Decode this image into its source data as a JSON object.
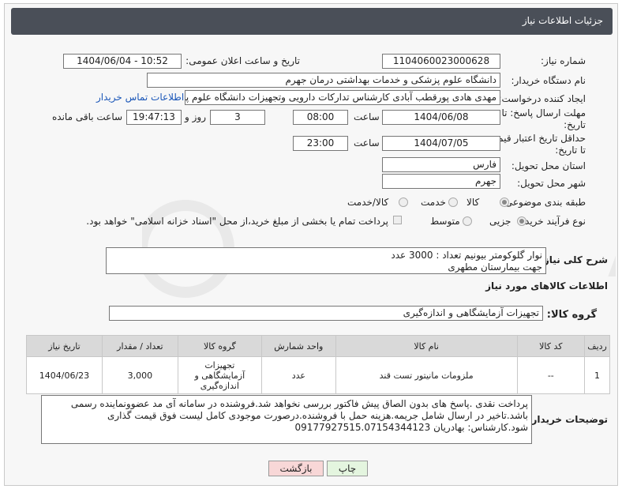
{
  "title": "جزئیات اطلاعات نیاز",
  "fields": {
    "need_number_label": "شماره نیاز:",
    "need_number": "1104060023000628",
    "announce_label": "تاریخ و ساعت اعلان عمومی:",
    "announce_value": "1404/06/04 - 10:52",
    "buyer_label": "نام دستگاه خریدار:",
    "buyer_value": "دانشگاه علوم پزشکی و خدمات بهداشتی  درمان جهرم",
    "creator_label": "ایجاد کننده درخواست:",
    "creator_value": "مهدی هادی پورقطب آبادی کارشناس تدارکات دارویی وتجهیزات دانشگاه علوم پزشکی جهرم",
    "contact_link": "اطلاعات تماس خریدار",
    "deadline_label_1": "مهلت ارسال پاسخ: تا",
    "deadline_label_2": "تاریخ:",
    "deadline_date": "1404/06/08",
    "time_label": "ساعت",
    "deadline_time": "08:00",
    "days_value": "3",
    "days_label": "روز و",
    "remaining_time": "19:47:13",
    "remaining_label": "ساعت باقی مانده",
    "validity_label_1": "حداقل تاریخ اعتبار قیمت:",
    "validity_label_2": "تا تاریخ:",
    "validity_date": "1404/07/05",
    "validity_time": "23:00",
    "province_label": "استان محل تحویل:",
    "province_value": "فارس",
    "city_label": "شهر محل تحویل:",
    "city_value": "جهرم",
    "category_label": "طبقه بندی موضوعی:",
    "category_options": [
      "کالا",
      "خدمت",
      "کالا/خدمت"
    ],
    "process_label": "نوع فرآیند خرید :",
    "process_options": [
      "جزیی",
      "متوسط"
    ],
    "payment_note": "پرداخت تمام یا بخشی از مبلغ خرید،از محل \"اسناد خزانه اسلامی\" خواهد بود.",
    "description_label": "شرح کلی نیاز:",
    "description_line1": "نوار گلوکومتر بیونیم        تعداد : 3000 عدد",
    "description_line2": "جهت بیمارستان مطهری",
    "goods_info_heading": "اطلاعات کالاهای مورد نیاز",
    "goods_group_label": "گروه کالا:",
    "goods_group_value": "تجهیزات آزمایشگاهی و اندازه‌گیری",
    "buyer_notes_label": "توضیحات خریدار:",
    "buyer_notes": "پرداخت نقدی .پاسخ های بدون الصاق پیش فاکتور بررسی نخواهد شد.فروشنده در سامانه آی مد عضوونماینده رسمی باشد.تاخیر در ارسال شامل جریمه.هزینه حمل با فروشنده.درصورت موجودی کامل لیست فوق قیمت گذاری شود.کارشناس: بهادریان 09177927515.07154344123"
  },
  "table": {
    "headers": [
      "ردیف",
      "کد کالا",
      "نام کالا",
      "واحد شمارش",
      "گروه کالا",
      "تعداد / مقدار",
      "تاریخ نیاز"
    ],
    "rows": [
      [
        "1",
        "--",
        "ملزومات مانیتور تست قند",
        "عدد",
        "تجهیزات آزمایشگاهی و اندازه‌گیری",
        "3,000",
        "1404/06/23"
      ]
    ]
  },
  "buttons": {
    "print": "چاپ",
    "back": "بازگشت"
  },
  "watermark": "AriaTender.neT",
  "colors": {
    "titlebar": "#4a4f58",
    "link": "#1a56b8",
    "back_button": "#f8d7d7",
    "print_button": "#e4f5df"
  }
}
